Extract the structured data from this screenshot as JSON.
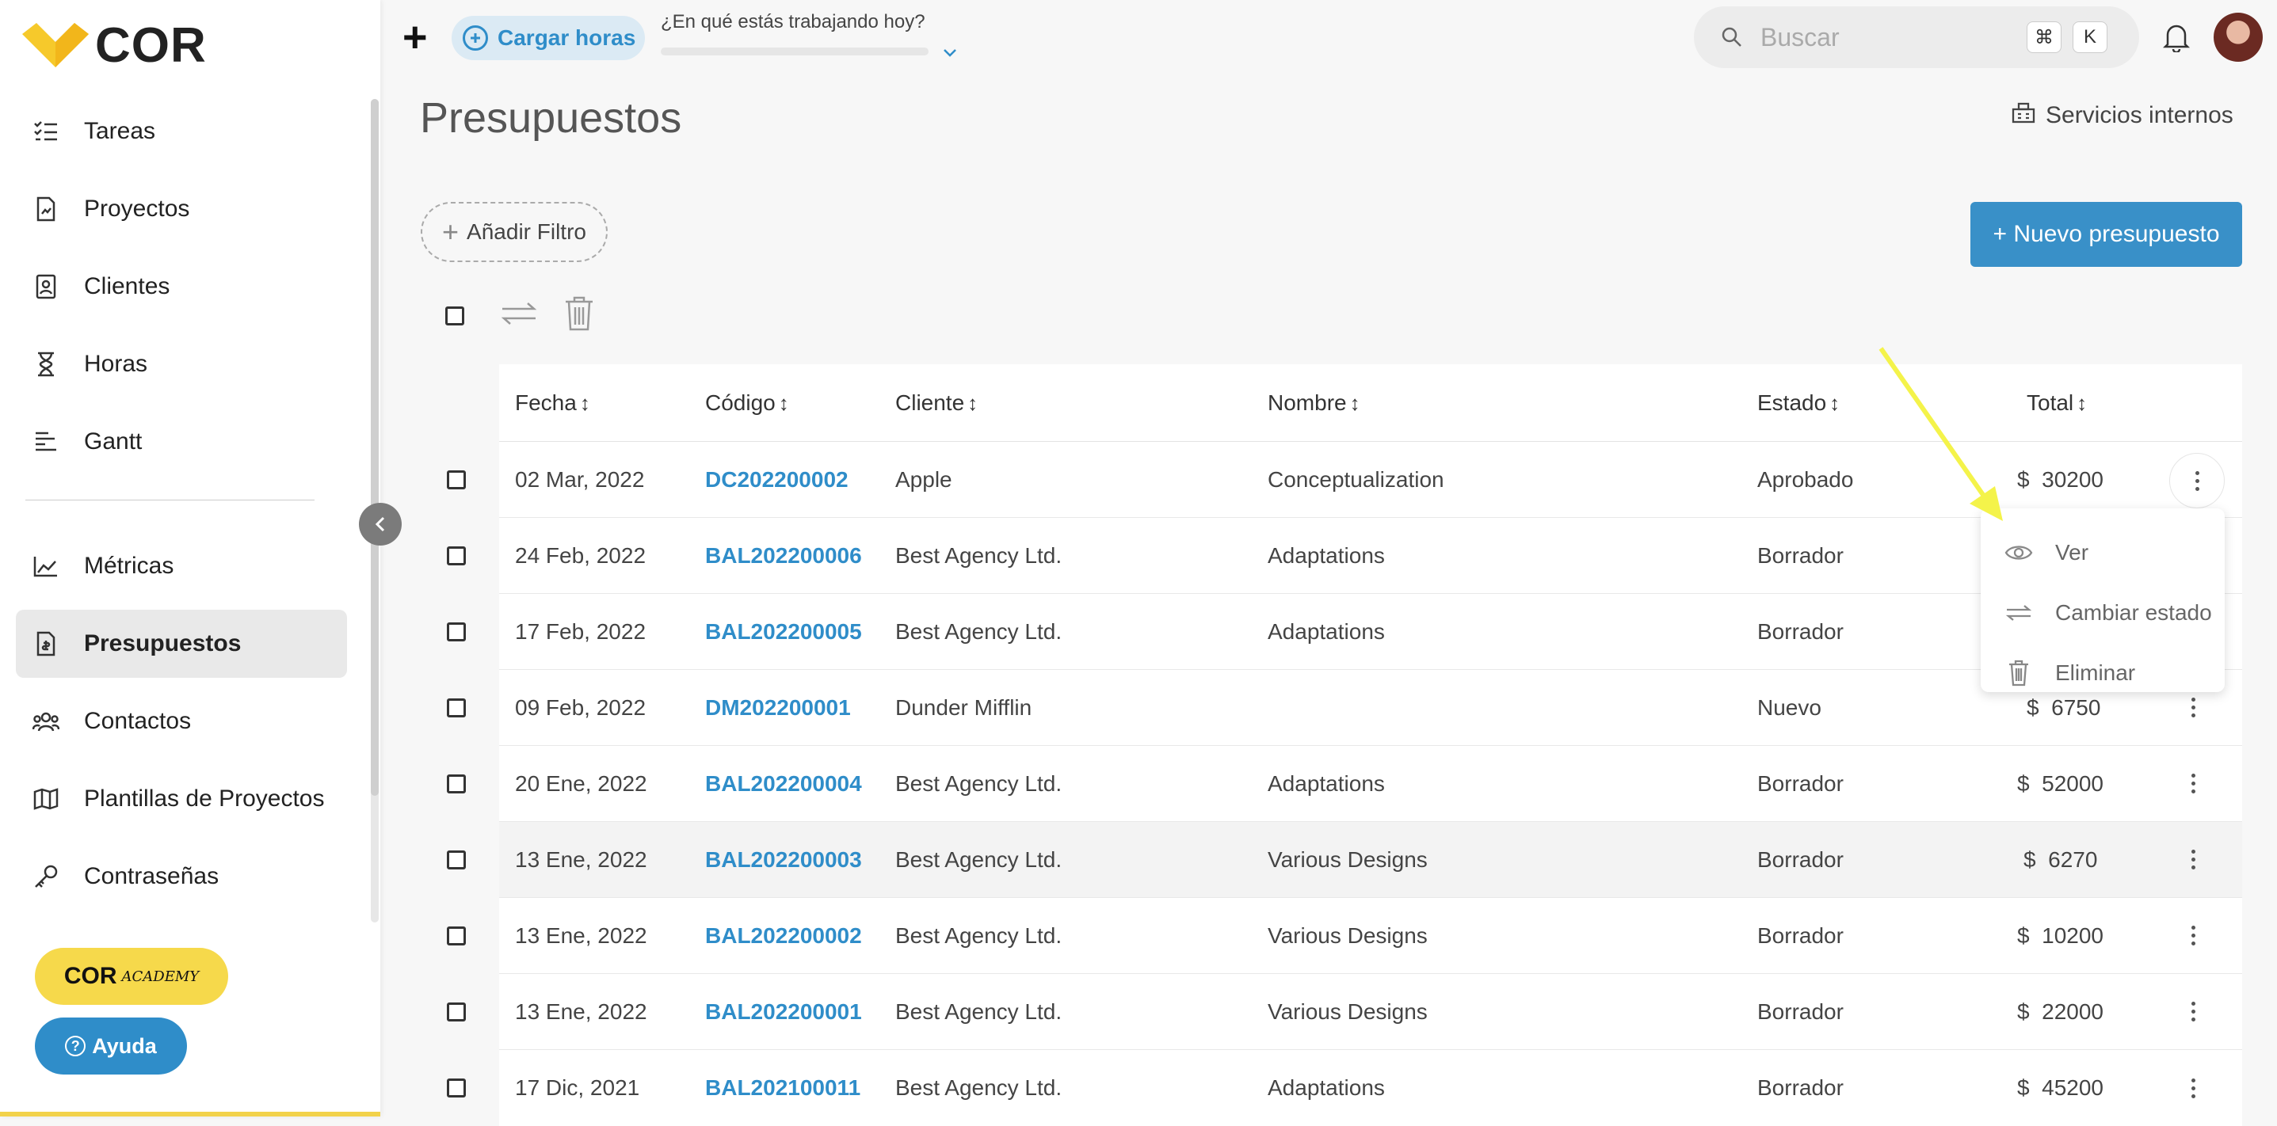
{
  "brand": {
    "name": "COR",
    "academy_label": "COR",
    "academy_script": "ACADEMY",
    "help_label": "Ayuda"
  },
  "sidebar": {
    "items": [
      {
        "label": "Tareas",
        "icon": "checklist-icon"
      },
      {
        "label": "Proyectos",
        "icon": "document-icon"
      },
      {
        "label": "Clientes",
        "icon": "contact-card-icon"
      },
      {
        "label": "Horas",
        "icon": "hourglass-icon"
      },
      {
        "label": "Gantt",
        "icon": "gantt-icon"
      },
      {
        "label": "Métricas",
        "icon": "chart-icon"
      },
      {
        "label": "Presupuestos",
        "icon": "invoice-icon"
      },
      {
        "label": "Contactos",
        "icon": "people-icon"
      },
      {
        "label": "Plantillas de Proyectos",
        "icon": "map-icon"
      },
      {
        "label": "Contraseñas",
        "icon": "key-icon"
      }
    ],
    "active": "Presupuestos"
  },
  "topbar": {
    "cargar_label": "Cargar horas",
    "working_prompt": "¿En qué estás trabajando hoy?",
    "search_placeholder": "Buscar",
    "kbd_cmd": "⌘",
    "kbd_k": "K"
  },
  "page": {
    "title": "Presupuestos",
    "servicios_label": "Servicios internos",
    "filter_label": "Añadir Filtro",
    "new_button": "+ Nuevo presupuesto"
  },
  "table": {
    "headers": {
      "fecha": "Fecha",
      "codigo": "Código",
      "cliente": "Cliente",
      "nombre": "Nombre",
      "estado": "Estado",
      "total": "Total"
    },
    "rows": [
      {
        "fecha": "02 Mar, 2022",
        "codigo": "DC202200002",
        "cliente": "Apple",
        "nombre": "Conceptualization",
        "estado": "Aprobado",
        "total": "$  30200"
      },
      {
        "fecha": "24 Feb, 2022",
        "codigo": "BAL202200006",
        "cliente": "Best Agency Ltd.",
        "nombre": "Adaptations",
        "estado": "Borrador",
        "total": ""
      },
      {
        "fecha": "17 Feb, 2022",
        "codigo": "BAL202200005",
        "cliente": "Best Agency Ltd.",
        "nombre": "Adaptations",
        "estado": "Borrador",
        "total": ""
      },
      {
        "fecha": "09 Feb, 2022",
        "codigo": "DM202200001",
        "cliente": "Dunder Mifflin",
        "nombre": "",
        "estado": "Nuevo",
        "total": "$  6750"
      },
      {
        "fecha": "20 Ene, 2022",
        "codigo": "BAL202200004",
        "cliente": "Best Agency Ltd.",
        "nombre": "Adaptations",
        "estado": "Borrador",
        "total": "$  52000"
      },
      {
        "fecha": "13 Ene, 2022",
        "codigo": "BAL202200003",
        "cliente": "Best Agency Ltd.",
        "nombre": "Various Designs",
        "estado": "Borrador",
        "total": "$  6270"
      },
      {
        "fecha": "13 Ene, 2022",
        "codigo": "BAL202200002",
        "cliente": "Best Agency Ltd.",
        "nombre": "Various Designs",
        "estado": "Borrador",
        "total": "$  10200"
      },
      {
        "fecha": "13 Ene, 2022",
        "codigo": "BAL202200001",
        "cliente": "Best Agency Ltd.",
        "nombre": "Various Designs",
        "estado": "Borrador",
        "total": "$  22000"
      },
      {
        "fecha": "17 Dic, 2021",
        "codigo": "BAL202100011",
        "cliente": "Best Agency Ltd.",
        "nombre": "Adaptations",
        "estado": "Borrador",
        "total": "$  45200"
      }
    ]
  },
  "row_menu": {
    "ver": "Ver",
    "cambiar": "Cambiar estado",
    "eliminar": "Eliminar"
  },
  "colors": {
    "accent": "#2f8dc9",
    "brand_yellow": "#f6d94b",
    "annotation_arrow": "#f4f34a"
  }
}
